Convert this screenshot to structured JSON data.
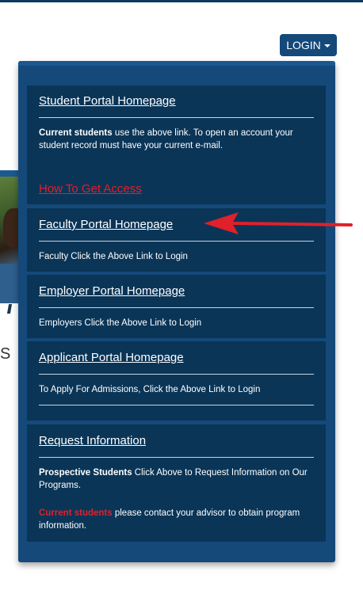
{
  "header": {
    "login_label": "LOGIN"
  },
  "background": {
    "partial_letter": "S"
  },
  "dropdown": {
    "student": {
      "title": "Student Portal Homepage",
      "desc_bold": "Current students",
      "desc_rest": " use the above link. To open an account your student record must have your current e-mail.",
      "access_link": "How To Get Access"
    },
    "faculty": {
      "title": "Faculty Portal Homepage",
      "desc": "Faculty Click the Above Link to Login"
    },
    "employer": {
      "title": "Employer Portal Homepage",
      "desc": "Employers Click the Above Link to Login"
    },
    "applicant": {
      "title": "Applicant Portal Homepage",
      "desc": "To Apply For Admissions, Click the Above Link to Login"
    },
    "request": {
      "title": "Request Information",
      "desc1_bold": "Prospective Students",
      "desc1_rest": " Click Above to Request Information on Our Programs.",
      "desc2_red": "Current students",
      "desc2_rest": " please contact your advisor to obtain program information."
    }
  },
  "colors": {
    "panel": "#14497a",
    "section": "#0a3557",
    "accent_red": "#e0202a"
  }
}
